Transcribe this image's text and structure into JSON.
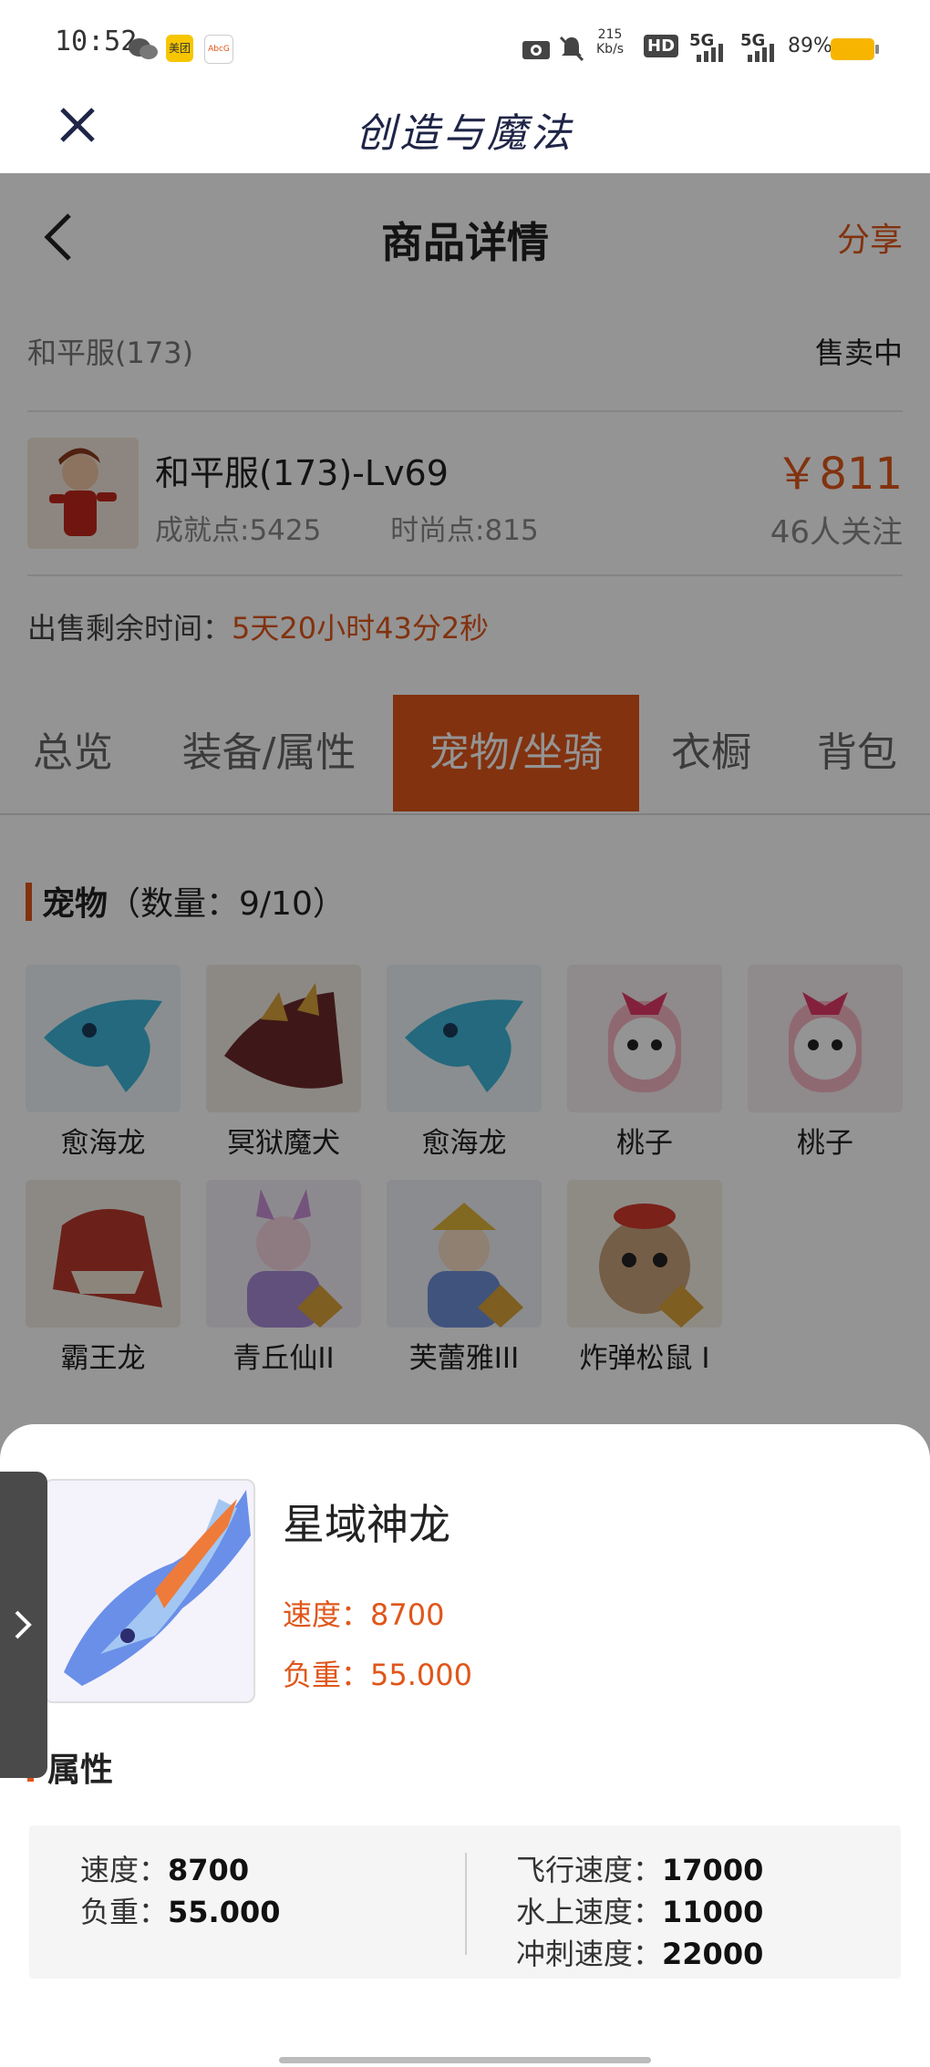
{
  "status_bar": {
    "time": "10:52",
    "network_speed_value": "215",
    "network_speed_unit": "Kb/s",
    "hd": "HD",
    "signal1": "5G",
    "signal2": "5G",
    "battery": "89%",
    "app_icon_1": "美团",
    "app_icon_2": "AbcG"
  },
  "app_bar": {
    "brand": "创造与魔法"
  },
  "nav": {
    "title": "商品详情",
    "share": "分享"
  },
  "listing": {
    "server": "和平服(173)",
    "status": "售卖中",
    "character_name": "和平服(173)-Lv69",
    "achievement": "成就点:5425",
    "fashion": "时尚点:815",
    "price": "￥811",
    "followers": "46人关注",
    "time_left_label": "出售剩余时间：",
    "time_left_value": "5天20小时43分2秒"
  },
  "tabs": [
    {
      "label": "总览"
    },
    {
      "label": "装备/属性"
    },
    {
      "label": "宠物/坐骑"
    },
    {
      "label": "衣橱"
    },
    {
      "label": "背包"
    }
  ],
  "pets_section": {
    "title": "宠物",
    "count": "（数量：9/10）",
    "items": [
      {
        "name": "愈海龙"
      },
      {
        "name": "冥狱魔犬"
      },
      {
        "name": "愈海龙"
      },
      {
        "name": "桃子"
      },
      {
        "name": "桃子"
      },
      {
        "name": "霸王龙"
      },
      {
        "name": "青丘仙II"
      },
      {
        "name": "芙蕾雅III"
      },
      {
        "name": "炸弹松鼠 I"
      }
    ]
  },
  "sheet": {
    "name": "星域神龙",
    "speed_label": "速度：8700",
    "load_label": "负重：55.000",
    "section_title": "属性",
    "left_attrs": [
      {
        "label": "速度：",
        "value": "8700"
      },
      {
        "label": "负重：",
        "value": "55.000"
      }
    ],
    "right_attrs": [
      {
        "label": "飞行速度：",
        "value": "17000"
      },
      {
        "label": "水上速度：",
        "value": "11000"
      },
      {
        "label": "冲刺速度：",
        "value": "22000"
      }
    ]
  },
  "colors": {
    "accent": "#e0561a",
    "brand_text": "#1f2547"
  }
}
